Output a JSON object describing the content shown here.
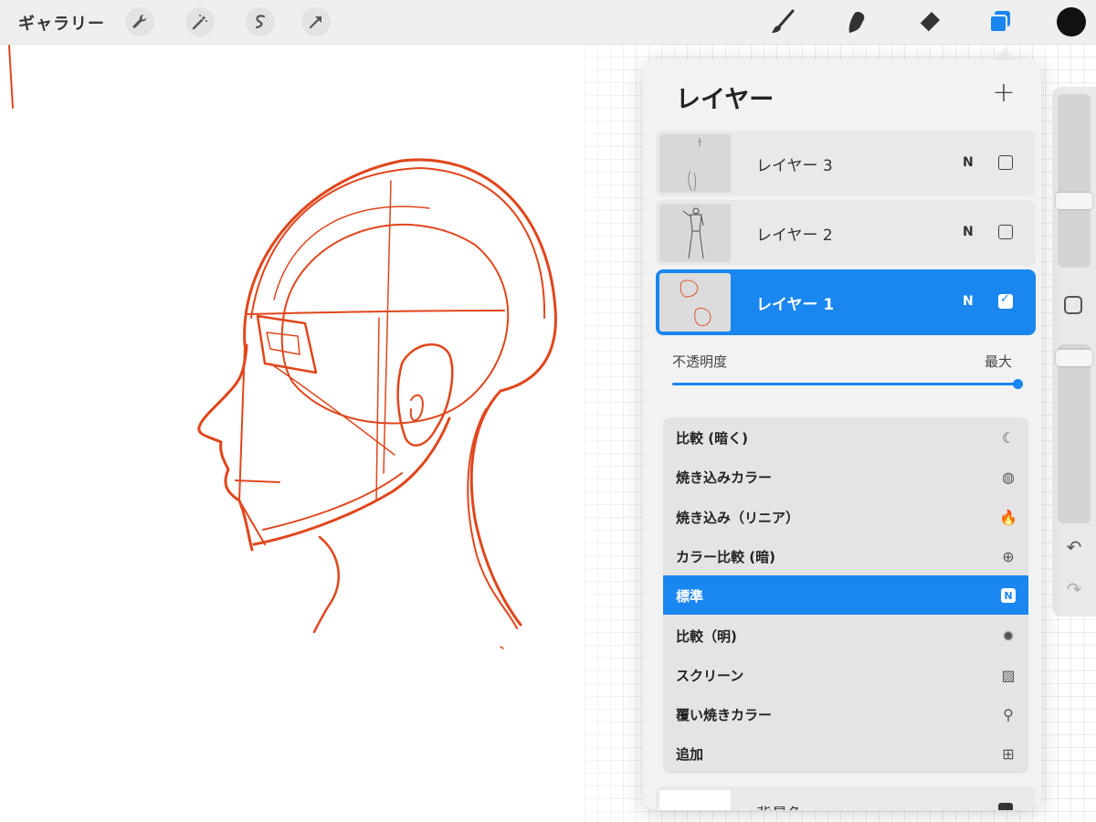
{
  "toolbar": {
    "gallery_label": "ギャラリー",
    "left_tools": [
      {
        "name": "wrench-icon",
        "glyph": "🔧"
      },
      {
        "name": "magic-wand-icon",
        "glyph": "✦"
      },
      {
        "name": "selection-icon",
        "glyph": "S"
      },
      {
        "name": "transform-arrow-icon",
        "glyph": "➚"
      }
    ],
    "right_tools": [
      {
        "name": "brush-icon"
      },
      {
        "name": "smudge-icon"
      },
      {
        "name": "eraser-icon"
      },
      {
        "name": "layers-icon",
        "active": true
      }
    ],
    "current_color": "#111111",
    "accent_color": "#1a86f0"
  },
  "layers_panel": {
    "title": "レイヤー",
    "add_glyph": "+",
    "layers": [
      {
        "name": "レイヤー 3",
        "mode": "N",
        "visible": false,
        "active": false
      },
      {
        "name": "レイヤー 2",
        "mode": "N",
        "visible": false,
        "active": false
      },
      {
        "name": "レイヤー 1",
        "mode": "N",
        "visible": true,
        "active": true
      }
    ],
    "opacity": {
      "label": "不透明度",
      "value_label": "最大",
      "value": 1.0
    },
    "blend_modes": [
      {
        "label": "比較 (暗く)",
        "icon": "moon-icon",
        "glyph": "☾",
        "selected": false
      },
      {
        "label": "焼き込みカラー",
        "icon": "burn-color-icon",
        "glyph": "◍",
        "selected": false
      },
      {
        "label": "焼き込み（リニア）",
        "icon": "flame-icon",
        "glyph": "🔥",
        "selected": false
      },
      {
        "label": "カラー比較 (暗)",
        "icon": "plus-circle-icon",
        "glyph": "⊕",
        "selected": false
      },
      {
        "label": "標準",
        "icon": "n-badge-icon",
        "glyph": "N",
        "selected": true
      },
      {
        "label": "比較（明)",
        "icon": "sun-burst-icon",
        "glyph": "✹",
        "selected": false
      },
      {
        "label": "スクリーン",
        "icon": "hatch-icon",
        "glyph": "▨",
        "selected": false
      },
      {
        "label": "覆い焼きカラー",
        "icon": "dodge-icon",
        "glyph": "⚲",
        "selected": false
      },
      {
        "label": "追加",
        "icon": "plus-square-icon",
        "glyph": "⊞",
        "selected": false
      }
    ],
    "background_layer": {
      "name": "背景色"
    }
  },
  "side_rail": {
    "undo_glyph": "↶",
    "redo_glyph": "↷"
  }
}
